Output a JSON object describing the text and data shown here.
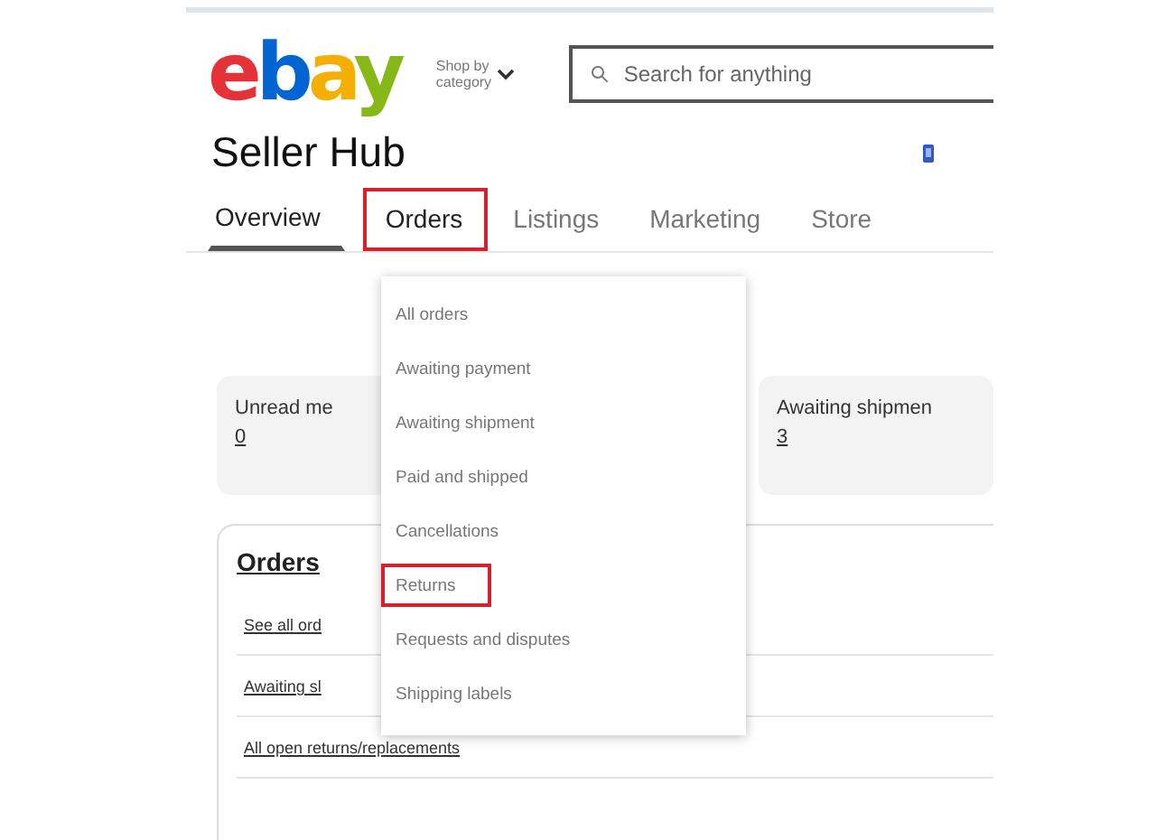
{
  "header": {
    "logo": [
      {
        "char": "e",
        "color": "#e53238"
      },
      {
        "char": "b",
        "color": "#0064d2"
      },
      {
        "char": "a",
        "color": "#f5af02"
      },
      {
        "char": "y",
        "color": "#86b817"
      }
    ],
    "shop_by": "Shop by category",
    "search": {
      "placeholder": "Search for anything"
    }
  },
  "page_title": "Seller Hub",
  "tabs": [
    {
      "label": "Overview",
      "selected": true,
      "highlighted": false
    },
    {
      "label": "Orders",
      "selected": false,
      "highlighted": true
    },
    {
      "label": "Listings",
      "selected": false,
      "highlighted": false
    },
    {
      "label": "Marketing",
      "selected": false,
      "highlighted": false
    },
    {
      "label": "Store",
      "selected": false,
      "highlighted": false
    }
  ],
  "menu": [
    {
      "label": "All orders",
      "highlighted": false
    },
    {
      "label": "Awaiting payment",
      "highlighted": false
    },
    {
      "label": "Awaiting shipment",
      "highlighted": false
    },
    {
      "label": "Paid and shipped",
      "highlighted": false
    },
    {
      "label": "Cancellations",
      "highlighted": false
    },
    {
      "label": "Returns",
      "highlighted": true
    },
    {
      "label": "Requests and disputes",
      "highlighted": false
    },
    {
      "label": "Shipping labels",
      "highlighted": false
    }
  ],
  "stats": [
    {
      "label": "Unread me",
      "value": "0"
    },
    {
      "label": "Awaiting shipmen",
      "value": "3"
    }
  ],
  "orders_panel": {
    "title": "Orders",
    "links": [
      "See all ord",
      "Awaiting sl",
      "All open returns/replacements"
    ]
  }
}
